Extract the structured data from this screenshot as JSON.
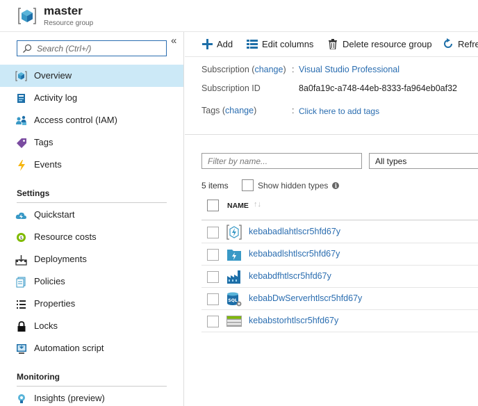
{
  "header": {
    "title": "master",
    "subtitle": "Resource group"
  },
  "sidebar": {
    "search_placeholder": "Search (Ctrl+/)",
    "collapse_glyph": "«",
    "top_items": [
      {
        "label": "Overview",
        "icon": "resource-group-icon",
        "active": true
      },
      {
        "label": "Activity log",
        "icon": "activity-log-icon"
      },
      {
        "label": "Access control (IAM)",
        "icon": "iam-icon"
      },
      {
        "label": "Tags",
        "icon": "tag-icon"
      },
      {
        "label": "Events",
        "icon": "lightning-icon"
      }
    ],
    "settings_header": "Settings",
    "settings_items": [
      {
        "label": "Quickstart",
        "icon": "quickstart-cloud-icon"
      },
      {
        "label": "Resource costs",
        "icon": "cost-icon"
      },
      {
        "label": "Deployments",
        "icon": "deployments-icon"
      },
      {
        "label": "Policies",
        "icon": "policies-icon"
      },
      {
        "label": "Properties",
        "icon": "properties-icon"
      },
      {
        "label": "Locks",
        "icon": "lock-icon"
      },
      {
        "label": "Automation script",
        "icon": "automation-script-icon"
      }
    ],
    "monitoring_header": "Monitoring",
    "monitoring_items": [
      {
        "label": "Insights (preview)",
        "icon": "insights-bulb-icon"
      }
    ]
  },
  "toolbar": {
    "add": "Add",
    "edit_columns": "Edit columns",
    "delete_rg": "Delete resource group",
    "refresh": "Refresh"
  },
  "essentials": {
    "subscription_label": "Subscription",
    "change": "change",
    "subscription_value": "Visual Studio Professional",
    "subscription_id_label": "Subscription ID",
    "subscription_id_value": "8a0fa19c-a748-44eb-8333-fa964eb0af32",
    "tags_label": "Tags",
    "tags_value": "Click here to add tags"
  },
  "resources": {
    "filter_placeholder": "Filter by name...",
    "type_filter": "All types",
    "count_text": "5 items",
    "show_hidden_label": "Show hidden types",
    "column_name": "NAME",
    "items": [
      {
        "name": "kebabadlahtlscr5hfd67y",
        "icon": "data-lake-analytics-icon"
      },
      {
        "name": "kebabadlshtlscr5hfd67y",
        "icon": "data-lake-store-icon"
      },
      {
        "name": "kebabdfhtlscr5hfd67y",
        "icon": "data-factory-icon"
      },
      {
        "name": "kebabDwServerhtlscr5hfd67y",
        "icon": "sql-server-icon"
      },
      {
        "name": "kebabstorhtlscr5hfd67y",
        "icon": "storage-account-icon"
      }
    ]
  },
  "colors": {
    "accent": "#2a6db0",
    "active_bg": "#cce9f7",
    "azure_blue": "#3999c6"
  }
}
